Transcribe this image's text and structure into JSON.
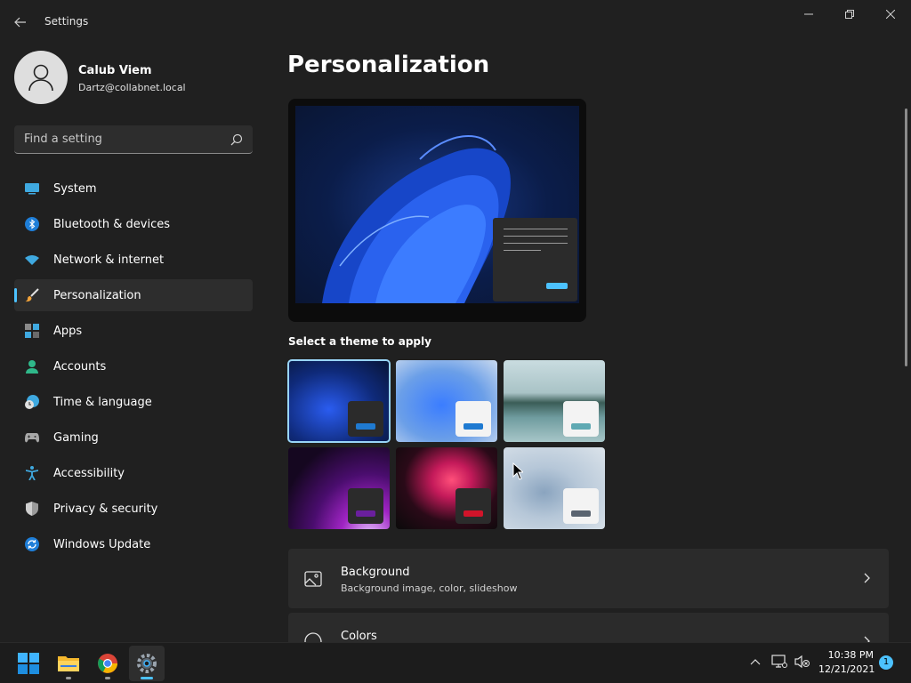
{
  "window": {
    "title": "Settings"
  },
  "profile": {
    "name": "Calub Viem",
    "email": "Dartz@collabnet.local"
  },
  "search": {
    "placeholder": "Find a setting"
  },
  "sidebar": {
    "items": [
      {
        "label": "System",
        "icon": "system-icon"
      },
      {
        "label": "Bluetooth & devices",
        "icon": "bluetooth-icon"
      },
      {
        "label": "Network & internet",
        "icon": "wifi-icon"
      },
      {
        "label": "Personalization",
        "icon": "brush-icon",
        "active": true
      },
      {
        "label": "Apps",
        "icon": "apps-icon"
      },
      {
        "label": "Accounts",
        "icon": "person-icon"
      },
      {
        "label": "Time & language",
        "icon": "clock-globe-icon"
      },
      {
        "label": "Gaming",
        "icon": "gamepad-icon"
      },
      {
        "label": "Accessibility",
        "icon": "accessibility-icon"
      },
      {
        "label": "Privacy & security",
        "icon": "shield-icon"
      },
      {
        "label": "Windows Update",
        "icon": "update-icon"
      }
    ]
  },
  "main": {
    "title": "Personalization",
    "theme_section_label": "Select a theme to apply",
    "themes": [
      {
        "name": "windows-dark",
        "selected": true,
        "accent": "#1f7ad1"
      },
      {
        "name": "windows-light",
        "selected": false,
        "accent": "#1f7ad1"
      },
      {
        "name": "glow",
        "selected": false,
        "accent": "#5fa9b3"
      },
      {
        "name": "captured-motion",
        "selected": false,
        "accent": "#6a1f9e"
      },
      {
        "name": "flow",
        "selected": false,
        "accent": "#d1142a"
      },
      {
        "name": "sunrise",
        "selected": false,
        "accent": "#5a6470"
      }
    ],
    "rows": [
      {
        "title": "Background",
        "subtitle": "Background image, color, slideshow",
        "icon": "image-icon"
      },
      {
        "title": "Colors",
        "subtitle": "",
        "icon": "palette-icon"
      }
    ]
  },
  "taskbar": {
    "apps": [
      "start-icon",
      "file-explorer-icon",
      "chrome-icon",
      "settings-icon"
    ],
    "time": "10:38 PM",
    "date": "12/21/2021",
    "notification_count": "1"
  },
  "colors": {
    "accent": "#4cc2ff",
    "background": "#202020",
    "card": "#2b2b2b"
  }
}
